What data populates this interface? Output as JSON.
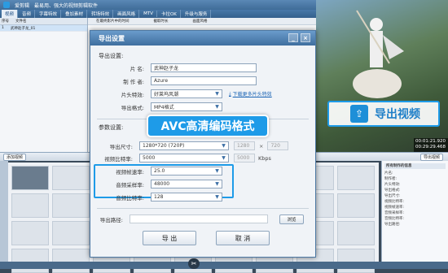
{
  "app": {
    "title": "爱剪辑",
    "subtitle": "最易用、强大的视频剪辑软件"
  },
  "menu": [
    "视频",
    "音频",
    "字幕特效",
    "叠加素材",
    "转场特效",
    "画面风格",
    "MTV",
    "卡拉OK",
    "升级与服务"
  ],
  "filelist": {
    "headers": [
      "序号",
      "文件名",
      "在最终影片中的时间",
      "截取时长"
    ],
    "rows": [
      {
        "num": "1",
        "name": "武神赵子龙_01",
        "time": "",
        "dur": ""
      }
    ]
  },
  "midpanel": {
    "cols": [
      "在最终影片中的时间",
      "截取时长",
      "画面风格"
    ]
  },
  "video": {
    "time_current": "00:01:21.920",
    "time_total": "00:29:29.468"
  },
  "export_callout": {
    "icon": "export-icon",
    "label": "导出视频"
  },
  "toolbar2": {
    "add_video": "添加视频",
    "export_btn": "导出视频"
  },
  "props": {
    "title": "所有制作的信息",
    "lines": [
      "片名:",
      "制作者:",
      "片头特效:",
      "导出格式:",
      "导出尺寸:",
      "视频比特率:",
      "视频帧速率:",
      "音频采样率:",
      "音频比特率:",
      "导出路径:"
    ]
  },
  "dialog": {
    "title": "导出设置",
    "min_btn": "_",
    "close_btn": "×",
    "section_export": "导出设置:",
    "section_params": "参数设置:",
    "name_label": "片      名:",
    "name_value": "武神赵子龙",
    "maker_label": "制  作  者:",
    "maker_value": "Azure",
    "intro_label": "片头特效:",
    "intro_value": "好莱坞风潮",
    "intro_link": "下载更多片头特效",
    "format_label": "导出格式:",
    "format_value": "MP4格式",
    "size_label": "导出尺寸:",
    "size_value": "1280*720 (720P)",
    "size_w": "1280",
    "size_x": "×",
    "size_h": "720",
    "vbit_label": "视频比特率:",
    "vbit_value": "5000",
    "vbit_custom": "5000",
    "vbit_unit": "Kbps",
    "fps_label": "视频帧速率:",
    "fps_value": "25.0",
    "asr_label": "音频采样率:",
    "asr_value": "48000",
    "abit_label": "音频比特率:",
    "abit_value": "128",
    "path_label": "导出路径:",
    "browse": "浏览",
    "ok": "导  出",
    "cancel": "取  消",
    "avc_tag": "AVC高清编码格式"
  },
  "colors": {
    "accent": "#1e9be8",
    "titlebar": "#4a7aa8"
  }
}
